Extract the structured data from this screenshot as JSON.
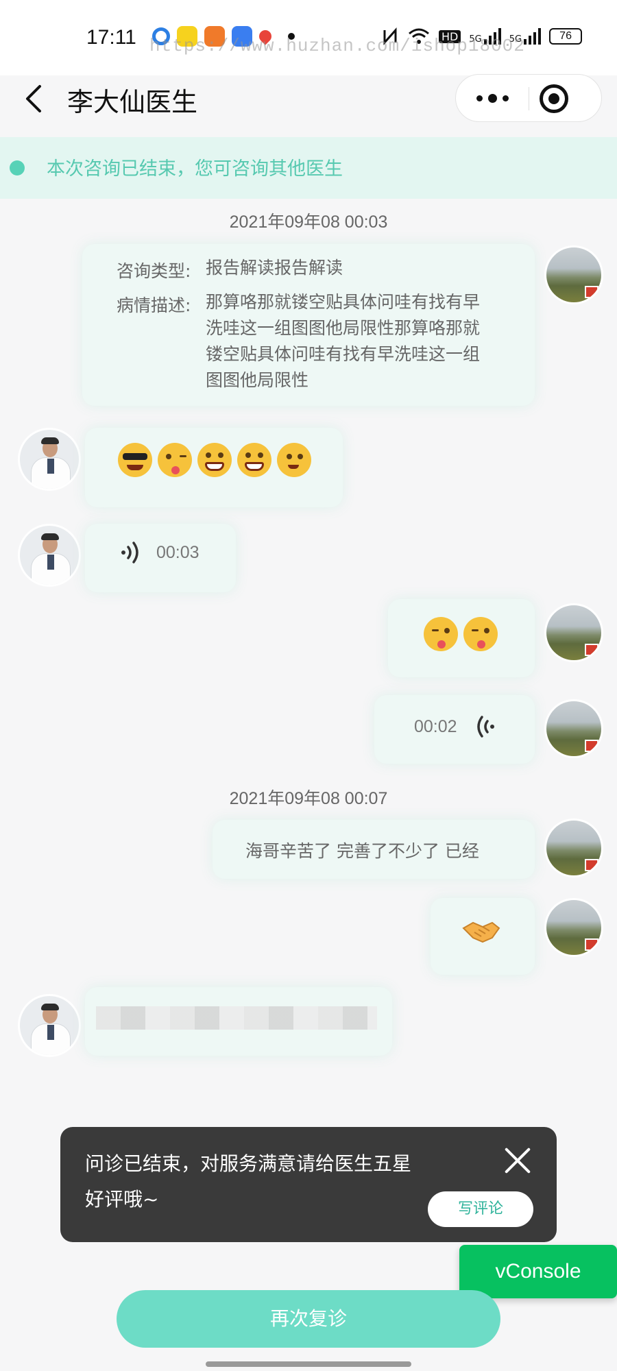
{
  "status_bar": {
    "time": "17:11",
    "network_1": "5G",
    "network_2": "5G",
    "hd_badge": "HD",
    "battery": "76",
    "watermark": "https://www.huzhan.com/ishop18002",
    "icons": [
      "location-icon",
      "app-icon",
      "app-icon",
      "chat-icon",
      "map-pin-icon",
      "nfc-icon",
      "wifi-icon"
    ]
  },
  "nav": {
    "title": "李大仙医生"
  },
  "banner": {
    "text": "本次咨询已结束，您可咨询其他医生",
    "color": "#57c9b0"
  },
  "messages": {
    "timestamp_1": "2021年09年08 00:03",
    "consult_type_label": "咨询类型:",
    "consult_type_value": "报告解读报告解读",
    "condition_label": "病情描述:",
    "condition_value": "那算咯那就镂空贴具体问哇有找有早洗哇这一组图图他局限性那算咯那就镂空贴具体问哇有找有早洗哇这一组图图他局限性",
    "doctor_voice_duration": "00:03",
    "user_voice_duration": "00:02",
    "timestamp_2": "2021年09年08 00:07",
    "user_text": "海哥辛苦了 完善了不少了 已经"
  },
  "toast": {
    "text": "问诊已结束，对服务满意请给医生五星好评哦~",
    "review_button": "写评论"
  },
  "vconsole": "vConsole",
  "primary_button": "再次复诊",
  "colors": {
    "accent": "#6ddcc6",
    "bubble": "#eef8f5",
    "vconsole": "#07c160"
  }
}
